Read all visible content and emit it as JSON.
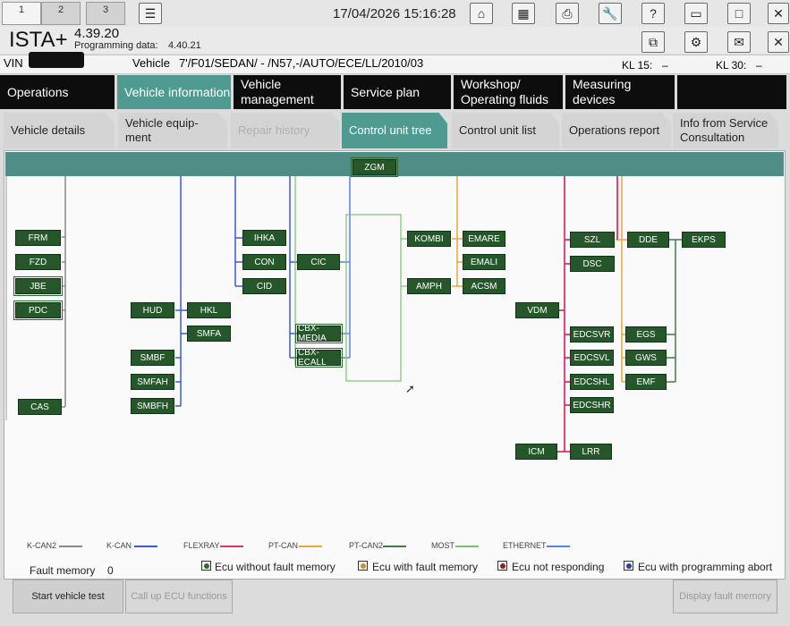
{
  "window_tabs": [
    "1",
    "2",
    "3"
  ],
  "datetime": "17/04/2026 15:16:28",
  "toolbar_icons": [
    "list-icon",
    "home-icon",
    "display-icon",
    "print-icon",
    "wrench-icon",
    "help-icon",
    "minimize-icon",
    "maximize-icon",
    "close-icon",
    "copy-icon",
    "settings-icon",
    "mail-icon"
  ],
  "toolbar": {
    "help_label": "?"
  },
  "app": {
    "name": "ISTA+",
    "version": "4.39.20",
    "programming_label": "Programming data:",
    "programming_value": "4.40.21"
  },
  "vinbar": {
    "vin_label": "VIN",
    "vehicle_label": "Vehicle",
    "vehicle_value": "7'/F01/SEDAN/ - /N57,-/AUTO/ECE/LL/2010/03",
    "kl15_label": "KL 15:",
    "kl15_value": "–",
    "kl30_label": "KL 30:",
    "kl30_value": "–"
  },
  "main_tabs": [
    "Operations",
    "Vehicle information",
    "Vehicle management",
    "Service plan",
    "Workshop/ Operating fluids",
    "Measuring devices",
    ""
  ],
  "sub_tabs": [
    "Vehicle details",
    "Vehicle equip- ment",
    "Repair history",
    "Control unit tree",
    "Control unit list",
    "Operations report",
    "Info from Service Consultation"
  ],
  "ecus": {
    "zgm": "ZGM",
    "frm": "FRM",
    "fzd": "FZD",
    "jbe": "JBE",
    "pdc": "PDC",
    "cas": "CAS",
    "hud": "HUD",
    "hkl": "HKL",
    "smfa": "SMFA",
    "smbf": "SMBF",
    "smfah": "SMFAH",
    "smbfh": "SMBFH",
    "ihka": "IHKA",
    "con": "CON",
    "cid": "CID",
    "cic": "CIC",
    "cbx_media": "CBX-MEDIA",
    "cbx_ecall": "CBX-ECALL",
    "kombi": "KOMBI",
    "amph": "AMPH",
    "emare": "EMARE",
    "emali": "EMALI",
    "acsm": "ACSM",
    "vdm": "VDM",
    "icm": "ICM",
    "szl": "SZL",
    "dsc": "DSC",
    "edcsvr": "EDCSVR",
    "edcsvl": "EDCSVL",
    "edcshl": "EDCSHL",
    "edcshr": "EDCSHR",
    "lrr": "LRR",
    "dde": "DDE",
    "ekps": "EKPS",
    "egs": "EGS",
    "gws": "GWS",
    "emf": "EMF"
  },
  "legend": [
    {
      "label": "K-CAN2",
      "color": "#8a8a8a"
    },
    {
      "label": "K-CAN",
      "color": "#3b5bd6"
    },
    {
      "label": "FLEXRAY",
      "color": "#e0336b"
    },
    {
      "label": "PT-CAN",
      "color": "#e8a83a"
    },
    {
      "label": "PT-CAN2",
      "color": "#3e7a48"
    },
    {
      "label": "MOST",
      "color": "#7cc06e"
    },
    {
      "label": "ETHERNET",
      "color": "#5a7ff0"
    }
  ],
  "fault_memory": {
    "label": "Fault memory",
    "value": "0"
  },
  "status_legend": [
    {
      "label": "Ecu without fault memory",
      "color": "#2e6b33"
    },
    {
      "label": "Ecu with fault memory",
      "color": "#c8902e"
    },
    {
      "label": "Ecu not responding",
      "color": "#9c1a1a"
    },
    {
      "label": "Ecu with programming abort",
      "color": "#2c3ea8"
    }
  ],
  "buttons": {
    "start_test": "Start vehicle test",
    "call_up": "Call up ECU functions",
    "display_fault": "Display fault memory"
  }
}
